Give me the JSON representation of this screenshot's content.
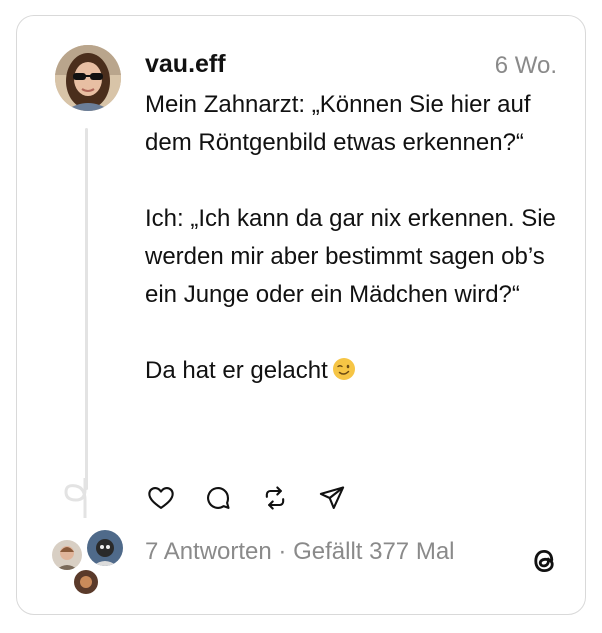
{
  "post": {
    "username": "vau.eff",
    "timestamp": "6 Wo.",
    "paragraphs": [
      "Mein Zahnarzt: „Können Sie hier auf dem Röntgenbild etwas erkennen?“",
      "Ich: „Ich kann da gar nix erkennen. Sie werden mir aber bestimmt sagen ob’s ein Junge oder ein Mädchen wird?“",
      "Da hat er gelacht"
    ],
    "emoji": "winking-face"
  },
  "actions": [
    "heart-icon",
    "comment-icon",
    "repost-icon",
    "share-icon"
  ],
  "stats": {
    "replies": "7 Antworten",
    "separator": " · ",
    "likes": "Gefällt 377 Mal"
  },
  "colors": {
    "border": "#d9d9d9",
    "text": "#111111",
    "muted": "#8a8a8a"
  }
}
